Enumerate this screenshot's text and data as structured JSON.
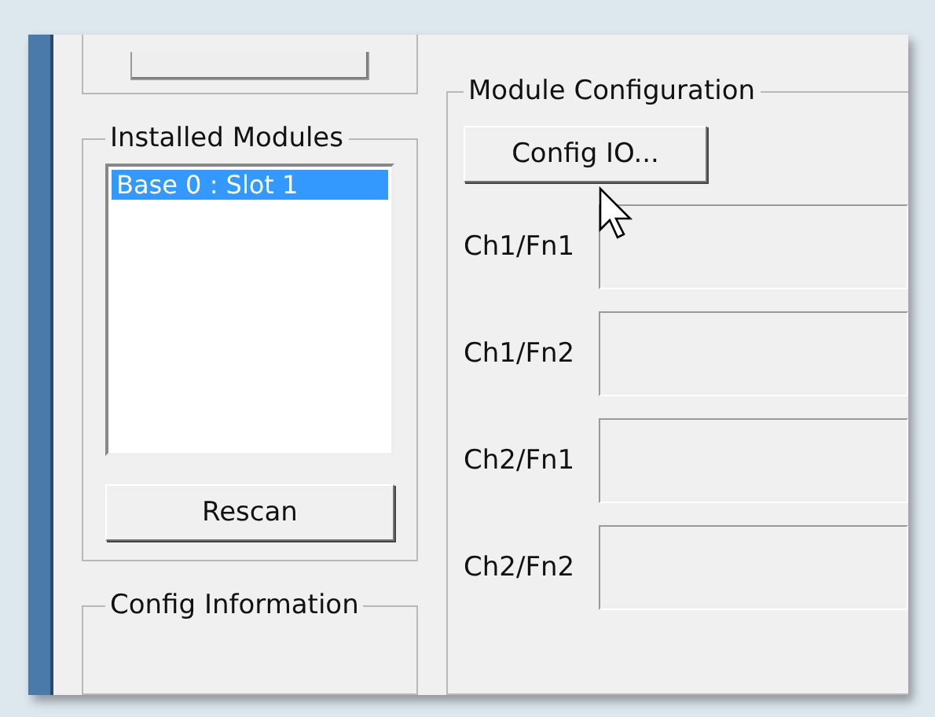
{
  "installed_modules": {
    "title": "Installed Modules",
    "items": [
      {
        "label": "Base 0 : Slot 1",
        "selected": true
      }
    ],
    "rescan_button": "Rescan"
  },
  "config_information": {
    "title": "Config Information"
  },
  "module_configuration": {
    "title": "Module Configuration",
    "config_button": "Config IO...",
    "channels": [
      {
        "label": "Ch1/Fn1"
      },
      {
        "label": "Ch1/Fn2"
      },
      {
        "label": "Ch2/Fn1"
      },
      {
        "label": "Ch2/Fn2"
      }
    ]
  }
}
